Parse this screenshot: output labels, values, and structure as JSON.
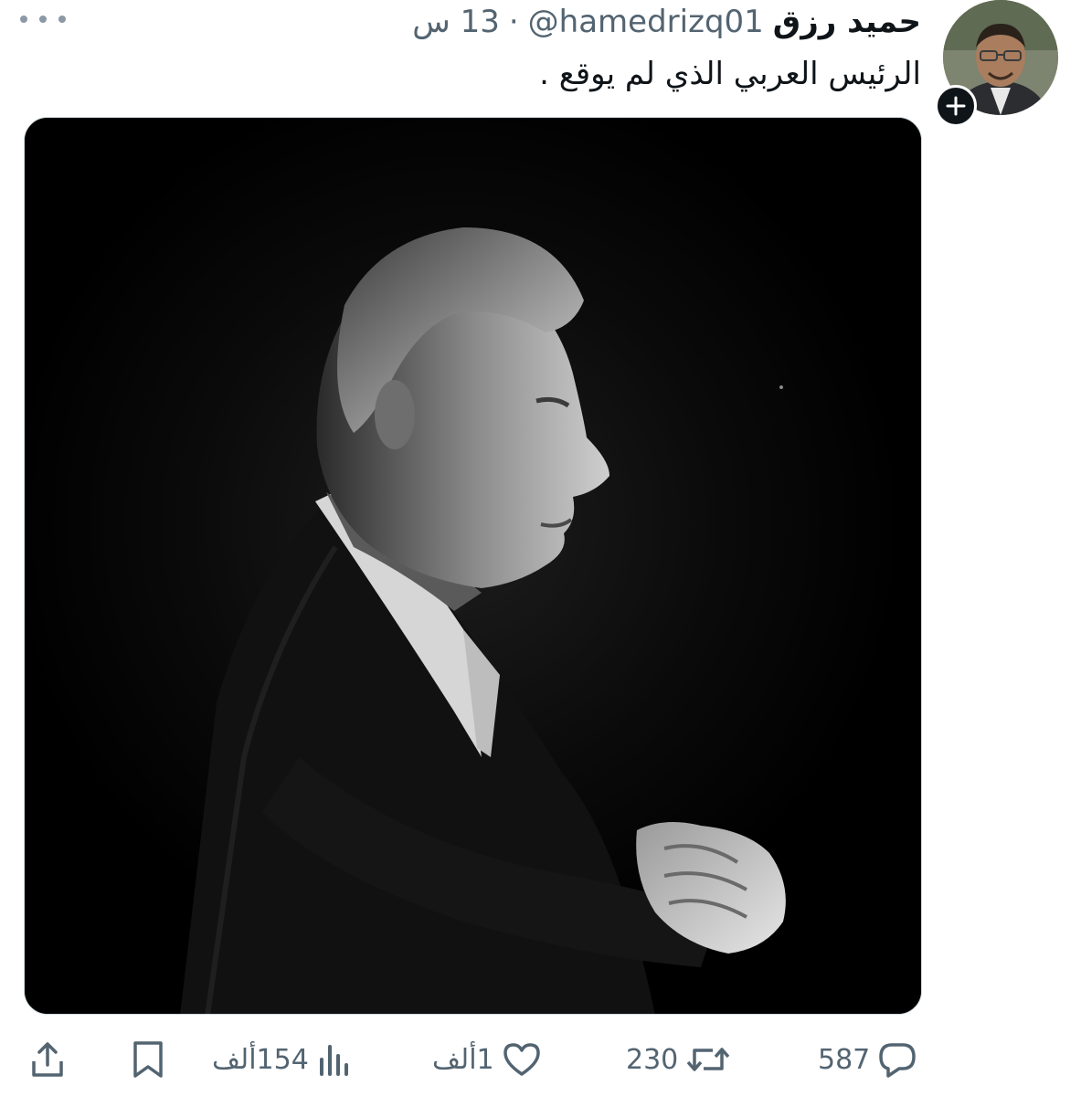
{
  "author": {
    "display_name": "حميد رزق",
    "handle": "@hamedrizq01",
    "separator": "·",
    "time": "13 س"
  },
  "tweet": {
    "text": "الرئيس العربي الذي لم يوقع ."
  },
  "icons": {
    "avatar": "user-avatar-photo",
    "follow": "plus-icon",
    "more": "more-dots-icon",
    "reply": "reply-bubble-icon",
    "retweet": "retweet-icon",
    "like": "heart-icon",
    "views": "views-bar-chart-icon",
    "bookmark": "bookmark-icon",
    "share": "share-upload-icon"
  },
  "actions": {
    "reply_count": "587",
    "retweet_count": "230",
    "like_count": "1ألف",
    "views_count": "154ألف"
  },
  "colors": {
    "text_primary": "#0f1419",
    "text_secondary": "#536471",
    "media_background": "#000000"
  }
}
